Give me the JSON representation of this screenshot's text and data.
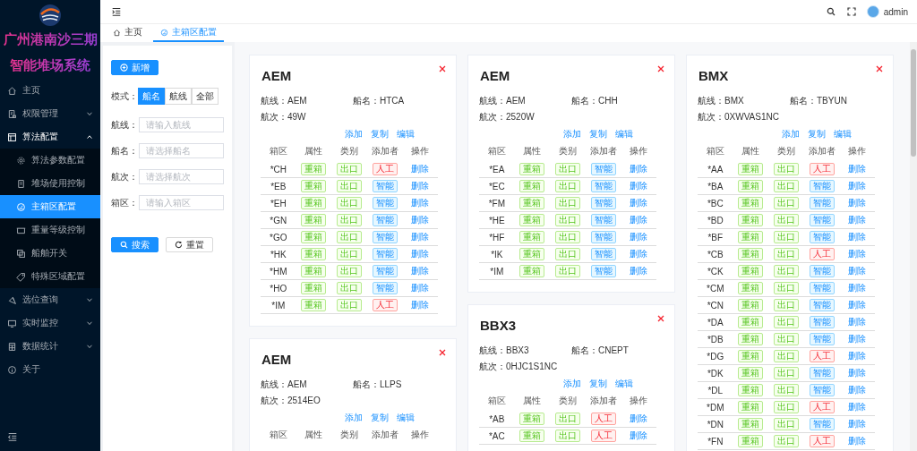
{
  "sidebar": {
    "logo_title": [
      "广州港南沙三期",
      "智能堆场系统"
    ],
    "menu": [
      {
        "kind": "link",
        "label": "主页",
        "selected": false
      },
      {
        "kind": "group",
        "label": "权限管理",
        "expanded": false,
        "selected": false
      },
      {
        "kind": "group",
        "label": "算法配置",
        "expanded": true,
        "selected": false,
        "children": [
          {
            "label": "算法参数配置",
            "selected": false
          },
          {
            "label": "堆场使用控制",
            "selected": false
          },
          {
            "label": "主箱区配置",
            "selected": true
          },
          {
            "label": "重量等级控制",
            "selected": false
          },
          {
            "label": "船舶开关",
            "selected": false
          },
          {
            "label": "特殊区域配置",
            "selected": false
          }
        ]
      },
      {
        "kind": "group",
        "label": "选位查询",
        "expanded": false,
        "selected": false
      },
      {
        "kind": "group",
        "label": "实时监控",
        "expanded": false,
        "selected": false
      },
      {
        "kind": "group",
        "label": "数据统计",
        "expanded": false,
        "selected": false
      },
      {
        "kind": "link",
        "label": "关于",
        "selected": false
      }
    ]
  },
  "header": {
    "user": "admin"
  },
  "tabs": [
    {
      "label": "主页",
      "selected": false
    },
    {
      "label": "主箱区配置",
      "selected": true
    }
  ],
  "filter": {
    "add_button": "新增",
    "mode_label": "模式：",
    "modes": [
      {
        "label": "船名",
        "selected": true
      },
      {
        "label": "航线",
        "selected": false
      },
      {
        "label": "全部",
        "selected": false
      }
    ],
    "fields": [
      {
        "label": "航线：",
        "placeholder": "请输入航线"
      },
      {
        "label": "船名：",
        "placeholder": "请选择船名"
      },
      {
        "label": "航次：",
        "placeholder": "请选择航次"
      },
      {
        "label": "箱区：",
        "placeholder": "请输入箱区"
      }
    ],
    "search_button": "搜索",
    "reset_button": "重置"
  },
  "card_columns": [
    [
      {
        "title": "AEM",
        "info": [
          {
            "label": "航线：",
            "value": "AEM"
          },
          {
            "label": "船名：",
            "value": "HTCA"
          },
          {
            "label": "航次：",
            "value": "49W"
          }
        ],
        "actions": [
          "添加",
          "复制",
          "编辑"
        ],
        "columns": [
          "箱区",
          "属性",
          "类别",
          "添加者",
          "操作"
        ],
        "rows": [
          {
            "zone": "*CH",
            "attribute": "重箱",
            "category": "出口",
            "adder": {
              "text": "人工",
              "kind": "manual"
            },
            "action": "删除"
          },
          {
            "zone": "*EB",
            "attribute": "重箱",
            "category": "出口",
            "adder": {
              "text": "智能",
              "kind": "smart"
            },
            "action": "删除"
          },
          {
            "zone": "*EH",
            "attribute": "重箱",
            "category": "出口",
            "adder": {
              "text": "智能",
              "kind": "smart"
            },
            "action": "删除"
          },
          {
            "zone": "*GN",
            "attribute": "重箱",
            "category": "出口",
            "adder": {
              "text": "智能",
              "kind": "smart"
            },
            "action": "删除"
          },
          {
            "zone": "*GO",
            "attribute": "重箱",
            "category": "出口",
            "adder": {
              "text": "智能",
              "kind": "smart"
            },
            "action": "删除"
          },
          {
            "zone": "*HK",
            "attribute": "重箱",
            "category": "出口",
            "adder": {
              "text": "智能",
              "kind": "smart"
            },
            "action": "删除"
          },
          {
            "zone": "*HM",
            "attribute": "重箱",
            "category": "出口",
            "adder": {
              "text": "智能",
              "kind": "smart"
            },
            "action": "删除"
          },
          {
            "zone": "*HO",
            "attribute": "重箱",
            "category": "出口",
            "adder": {
              "text": "智能",
              "kind": "smart"
            },
            "action": "删除"
          },
          {
            "zone": "*IM",
            "attribute": "重箱",
            "category": "出口",
            "adder": {
              "text": "人工",
              "kind": "manual"
            },
            "action": "删除"
          }
        ]
      },
      {
        "title": "AEM",
        "info": [
          {
            "label": "航线：",
            "value": "AEM"
          },
          {
            "label": "船名：",
            "value": "LLPS"
          },
          {
            "label": "航次：",
            "value": "2514EO"
          }
        ],
        "actions": [
          "添加",
          "复制",
          "编辑"
        ],
        "columns": [
          "箱区",
          "属性",
          "类别",
          "添加者",
          "操作"
        ]
      }
    ],
    [
      {
        "title": "AEM",
        "info": [
          {
            "label": "航线：",
            "value": "AEM"
          },
          {
            "label": "船名：",
            "value": "CHH"
          },
          {
            "label": "航次：",
            "value": "2520W"
          }
        ],
        "actions": [
          "添加",
          "复制",
          "编辑"
        ],
        "columns": [
          "箱区",
          "属性",
          "类别",
          "添加者",
          "操作"
        ],
        "rows": [
          {
            "zone": "*EA",
            "attribute": "重箱",
            "category": "出口",
            "adder": {
              "text": "智能",
              "kind": "smart"
            },
            "action": "删除"
          },
          {
            "zone": "*EC",
            "attribute": "重箱",
            "category": "出口",
            "adder": {
              "text": "智能",
              "kind": "smart"
            },
            "action": "删除"
          },
          {
            "zone": "*FM",
            "attribute": "重箱",
            "category": "出口",
            "adder": {
              "text": "智能",
              "kind": "smart"
            },
            "action": "删除"
          },
          {
            "zone": "*HE",
            "attribute": "重箱",
            "category": "出口",
            "adder": {
              "text": "智能",
              "kind": "smart"
            },
            "action": "删除"
          },
          {
            "zone": "*HF",
            "attribute": "重箱",
            "category": "出口",
            "adder": {
              "text": "智能",
              "kind": "smart"
            },
            "action": "删除"
          },
          {
            "zone": "*IK",
            "attribute": "重箱",
            "category": "出口",
            "adder": {
              "text": "智能",
              "kind": "smart"
            },
            "action": "删除"
          },
          {
            "zone": "*IM",
            "attribute": "重箱",
            "category": "出口",
            "adder": {
              "text": "智能",
              "kind": "smart"
            },
            "action": "删除"
          }
        ]
      },
      {
        "title": "BBX3",
        "info": [
          {
            "label": "航线：",
            "value": "BBX3"
          },
          {
            "label": "船名：",
            "value": "CNEPT"
          },
          {
            "label": "航次：",
            "value": "0HJC1S1NC"
          }
        ],
        "actions": [
          "添加",
          "复制",
          "编辑"
        ],
        "columns": [
          "箱区",
          "属性",
          "类别",
          "添加者",
          "操作"
        ],
        "rows": [
          {
            "zone": "*AB",
            "attribute": "重箱",
            "category": "出口",
            "adder": {
              "text": "人工",
              "kind": "manual"
            },
            "action": "删除"
          },
          {
            "zone": "*AC",
            "attribute": "重箱",
            "category": "出口",
            "adder": {
              "text": "人工",
              "kind": "manual"
            },
            "action": "删除"
          }
        ]
      }
    ],
    [
      {
        "title": "BMX",
        "info": [
          {
            "label": "航线：",
            "value": "BMX"
          },
          {
            "label": "船名：",
            "value": "TBYUN"
          },
          {
            "label": "航次：",
            "value": "0XWVAS1NC"
          }
        ],
        "actions": [
          "添加",
          "复制",
          "编辑"
        ],
        "columns": [
          "箱区",
          "属性",
          "类别",
          "添加者",
          "操作"
        ],
        "rows": [
          {
            "zone": "*AA",
            "attribute": "重箱",
            "category": "出口",
            "adder": {
              "text": "人工",
              "kind": "manual"
            },
            "action": "删除"
          },
          {
            "zone": "*BA",
            "attribute": "重箱",
            "category": "出口",
            "adder": {
              "text": "智能",
              "kind": "smart"
            },
            "action": "删除"
          },
          {
            "zone": "*BC",
            "attribute": "重箱",
            "category": "出口",
            "adder": {
              "text": "智能",
              "kind": "smart"
            },
            "action": "删除"
          },
          {
            "zone": "*BD",
            "attribute": "重箱",
            "category": "出口",
            "adder": {
              "text": "智能",
              "kind": "smart"
            },
            "action": "删除"
          },
          {
            "zone": "*BF",
            "attribute": "重箱",
            "category": "出口",
            "adder": {
              "text": "智能",
              "kind": "smart"
            },
            "action": "删除"
          },
          {
            "zone": "*CB",
            "attribute": "重箱",
            "category": "出口",
            "adder": {
              "text": "人工",
              "kind": "manual"
            },
            "action": "删除"
          },
          {
            "zone": "*CK",
            "attribute": "重箱",
            "category": "出口",
            "adder": {
              "text": "智能",
              "kind": "smart"
            },
            "action": "删除"
          },
          {
            "zone": "*CM",
            "attribute": "重箱",
            "category": "出口",
            "adder": {
              "text": "智能",
              "kind": "smart"
            },
            "action": "删除"
          },
          {
            "zone": "*CN",
            "attribute": "重箱",
            "category": "出口",
            "adder": {
              "text": "智能",
              "kind": "smart"
            },
            "action": "删除"
          },
          {
            "zone": "*DA",
            "attribute": "重箱",
            "category": "出口",
            "adder": {
              "text": "智能",
              "kind": "smart"
            },
            "action": "删除"
          },
          {
            "zone": "*DB",
            "attribute": "重箱",
            "category": "出口",
            "adder": {
              "text": "智能",
              "kind": "smart"
            },
            "action": "删除"
          },
          {
            "zone": "*DG",
            "attribute": "重箱",
            "category": "出口",
            "adder": {
              "text": "人工",
              "kind": "manual"
            },
            "action": "删除"
          },
          {
            "zone": "*DK",
            "attribute": "重箱",
            "category": "出口",
            "adder": {
              "text": "智能",
              "kind": "smart"
            },
            "action": "删除"
          },
          {
            "zone": "*DL",
            "attribute": "重箱",
            "category": "出口",
            "adder": {
              "text": "智能",
              "kind": "smart"
            },
            "action": "删除"
          },
          {
            "zone": "*DM",
            "attribute": "重箱",
            "category": "出口",
            "adder": {
              "text": "人工",
              "kind": "manual"
            },
            "action": "删除"
          },
          {
            "zone": "*DN",
            "attribute": "重箱",
            "category": "出口",
            "adder": {
              "text": "智能",
              "kind": "smart"
            },
            "action": "删除"
          },
          {
            "zone": "*FN",
            "attribute": "重箱",
            "category": "出口",
            "adder": {
              "text": "人工",
              "kind": "manual"
            },
            "action": "删除"
          }
        ]
      }
    ]
  ]
}
